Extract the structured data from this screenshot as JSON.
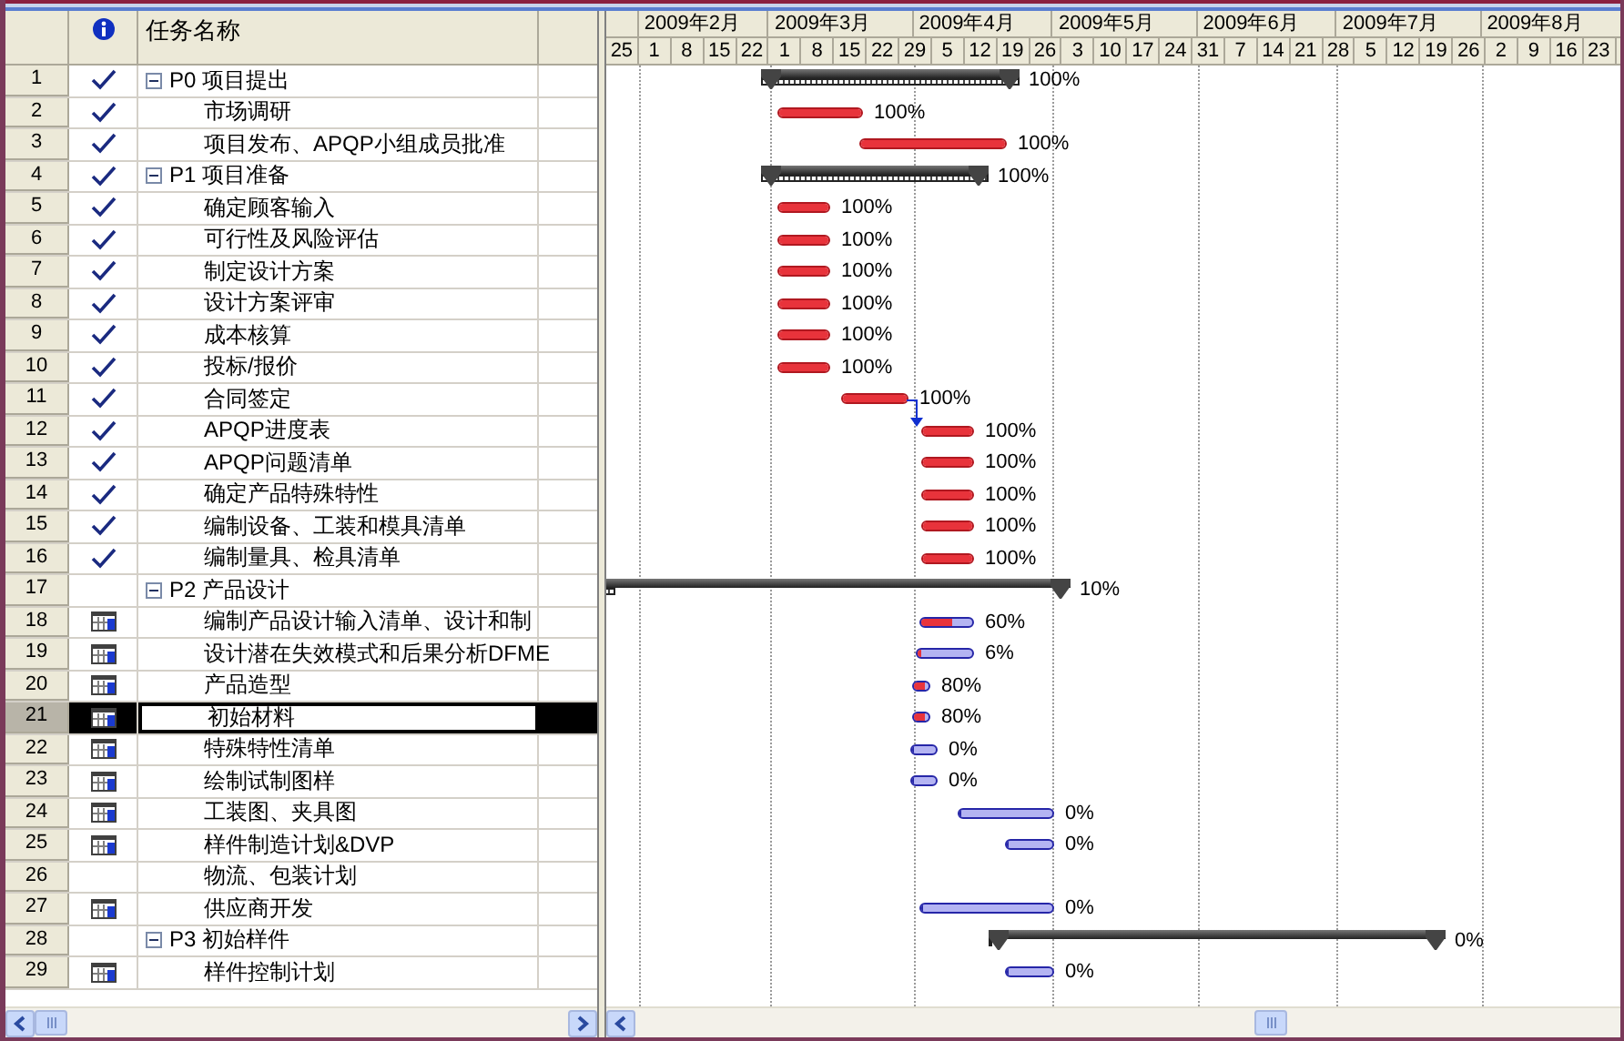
{
  "table": {
    "name_header": "任务名称"
  },
  "timescale": {
    "months": [
      "2009年2月",
      "2009年3月",
      "2009年4月",
      "2009年5月",
      "2009年6月",
      "2009年7月",
      "2009年8月"
    ],
    "weeks": [
      "25",
      "1",
      "8",
      "15",
      "22",
      "1",
      "8",
      "15",
      "22",
      "29",
      "5",
      "12",
      "19",
      "26",
      "3",
      "10",
      "17",
      "24",
      "31",
      "7",
      "14",
      "21",
      "28",
      "5",
      "12",
      "19",
      "26",
      "2",
      "9",
      "16",
      "23"
    ]
  },
  "tasks": [
    {
      "row_number": "1",
      "name": "P0 项目提出",
      "completed": true,
      "calendar": false,
      "selected": false,
      "expanded": true,
      "level": 1,
      "percent": "100%",
      "children": [
        {
          "row_number": "2",
          "name": "市场调研",
          "completed": true,
          "calendar": false,
          "selected": false,
          "level": 1,
          "percent": "100%"
        },
        {
          "row_number": "3",
          "name": "项目发布、APQP小组成员批准",
          "completed": true,
          "calendar": false,
          "selected": false,
          "level": 1,
          "percent": "100%"
        }
      ]
    },
    {
      "row_number": "4",
      "name": "P1 项目准备",
      "completed": true,
      "calendar": false,
      "selected": false,
      "expanded": true,
      "level": 1,
      "percent": "100%",
      "children": [
        {
          "row_number": "5",
          "name": "确定顾客输入",
          "completed": true,
          "calendar": false,
          "selected": false,
          "level": 1,
          "percent": "100%"
        },
        {
          "row_number": "6",
          "name": "可行性及风险评估",
          "completed": true,
          "calendar": false,
          "selected": false,
          "level": 1,
          "percent": "100%"
        },
        {
          "row_number": "7",
          "name": "制定设计方案",
          "completed": true,
          "calendar": false,
          "selected": false,
          "level": 1,
          "percent": "100%"
        },
        {
          "row_number": "8",
          "name": "设计方案评审",
          "completed": true,
          "calendar": false,
          "selected": false,
          "level": 1,
          "percent": "100%"
        },
        {
          "row_number": "9",
          "name": "成本核算",
          "completed": true,
          "calendar": false,
          "selected": false,
          "level": 1,
          "percent": "100%"
        },
        {
          "row_number": "10",
          "name": "投标/报价",
          "completed": true,
          "calendar": false,
          "selected": false,
          "level": 1,
          "percent": "100%"
        },
        {
          "row_number": "11",
          "name": "合同签定",
          "completed": true,
          "calendar": false,
          "selected": false,
          "level": 1,
          "percent": "100%"
        },
        {
          "row_number": "12",
          "name": "APQP进度表",
          "completed": true,
          "calendar": false,
          "selected": false,
          "level": 1,
          "percent": "100%"
        },
        {
          "row_number": "13",
          "name": "APQP问题清单",
          "completed": true,
          "calendar": false,
          "selected": false,
          "level": 1,
          "percent": "100%"
        },
        {
          "row_number": "14",
          "name": "确定产品特殊特性",
          "completed": true,
          "calendar": false,
          "selected": false,
          "level": 1,
          "percent": "100%"
        },
        {
          "row_number": "15",
          "name": "编制设备、工装和模具清单",
          "completed": true,
          "calendar": false,
          "selected": false,
          "level": 1,
          "percent": "100%"
        },
        {
          "row_number": "16",
          "name": "编制量具、检具清单",
          "completed": true,
          "calendar": false,
          "selected": false,
          "level": 1,
          "percent": "100%"
        }
      ]
    },
    {
      "row_number": "17",
      "name": "P2 产品设计",
      "completed": false,
      "calendar": false,
      "selected": false,
      "expanded": true,
      "level": 0.1,
      "percent": "10%",
      "children": [
        {
          "row_number": "18",
          "name": "编制产品设计输入清单、设计和制",
          "completed": false,
          "calendar": true,
          "selected": false,
          "level": 0.6,
          "percent": "60%"
        },
        {
          "row_number": "19",
          "name": "设计潜在失效模式和后果分析DFME",
          "completed": false,
          "calendar": true,
          "selected": false,
          "level": 0.06,
          "percent": "6%"
        },
        {
          "row_number": "20",
          "name": "产品造型",
          "completed": false,
          "calendar": true,
          "selected": false,
          "level": 0.8,
          "percent": "80%"
        },
        {
          "row_number": "21",
          "name": "初始材料",
          "completed": false,
          "calendar": true,
          "selected": true,
          "level": 0.8,
          "percent": "80%"
        },
        {
          "row_number": "22",
          "name": "特殊特性清单",
          "completed": false,
          "calendar": true,
          "selected": false,
          "level": 0,
          "percent": "0%"
        },
        {
          "row_number": "23",
          "name": "绘制试制图样",
          "completed": false,
          "calendar": true,
          "selected": false,
          "level": 0,
          "percent": "0%"
        },
        {
          "row_number": "24",
          "name": "工装图、夹具图",
          "completed": false,
          "calendar": true,
          "selected": false,
          "level": 0,
          "percent": "0%"
        },
        {
          "row_number": "25",
          "name": "样件制造计划&DVP",
          "completed": false,
          "calendar": true,
          "selected": false,
          "level": 0,
          "percent": "0%"
        },
        {
          "row_number": "26",
          "name": "物流、包装计划",
          "completed": false,
          "calendar": false,
          "selected": false
        },
        {
          "row_number": "27",
          "name": "供应商开发",
          "completed": false,
          "calendar": true,
          "selected": false,
          "level": 0,
          "percent": "0%"
        }
      ]
    },
    {
      "row_number": "28",
      "name": "P3 初始样件",
      "completed": false,
      "calendar": false,
      "selected": false,
      "expanded": true,
      "level": 0,
      "percent": "0%",
      "children": [
        {
          "row_number": "29",
          "name": "样件控制计划",
          "completed": false,
          "calendar": true,
          "selected": false,
          "level": 0,
          "percent": "0%"
        }
      ]
    }
  ]
}
